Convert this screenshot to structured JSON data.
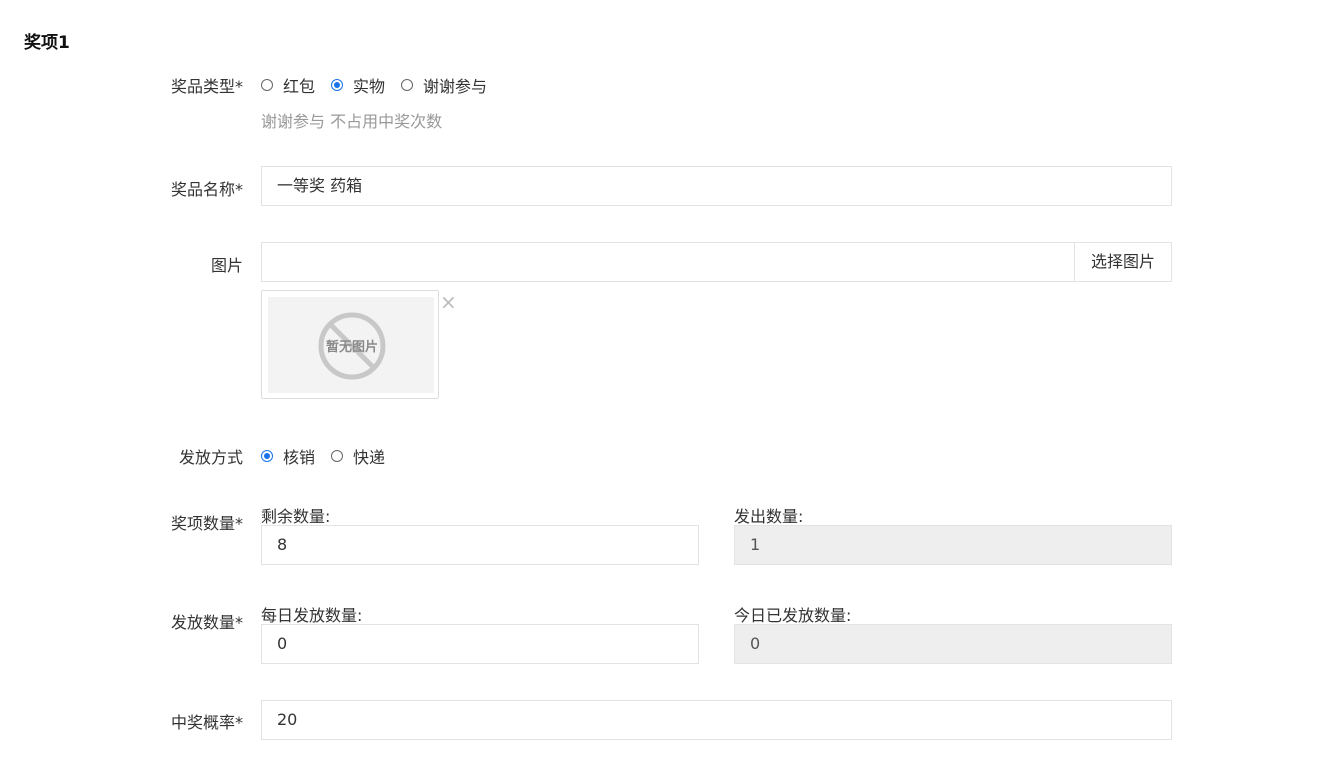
{
  "section": {
    "title": "奖项1"
  },
  "prize_type": {
    "label": "奖品类型*",
    "options": [
      {
        "label": "红包",
        "checked": false
      },
      {
        "label": "实物",
        "checked": true
      },
      {
        "label": "谢谢参与",
        "checked": false
      }
    ],
    "hint": "谢谢参与 不占用中奖次数"
  },
  "prize_name": {
    "label": "奖品名称*",
    "value": "一等奖  药箱"
  },
  "image": {
    "label": "图片",
    "value": "",
    "select_button": "选择图片",
    "placeholder_text": "暂无图片",
    "remove": "×"
  },
  "delivery": {
    "label": "发放方式",
    "options": [
      {
        "label": "核销",
        "checked": true
      },
      {
        "label": "快递",
        "checked": false
      }
    ]
  },
  "quantity": {
    "label": "奖项数量*",
    "remaining_label": "剩余数量:",
    "remaining_value": "8",
    "issued_label": "发出数量:",
    "issued_value": "1"
  },
  "distribution": {
    "label": "发放数量*",
    "daily_label": "每日发放数量:",
    "daily_value": "0",
    "today_label": "今日已发放数量:",
    "today_value": "0"
  },
  "probability": {
    "label": "中奖概率*",
    "value": "20"
  }
}
